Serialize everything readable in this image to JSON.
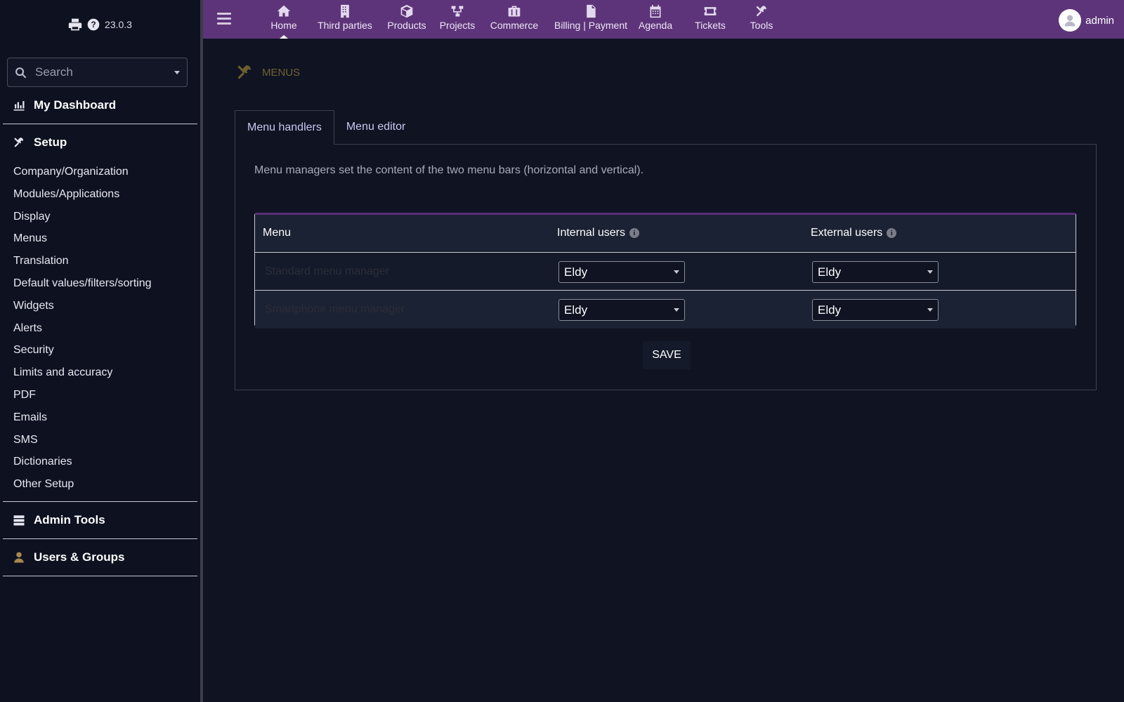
{
  "app": {
    "version": "23.0.3"
  },
  "search": {
    "placeholder": "Search"
  },
  "sidebar": {
    "dashboard_label": "My Dashboard",
    "setup_label": "Setup",
    "setup_items": [
      {
        "label": "Company/Organization"
      },
      {
        "label": "Modules/Applications"
      },
      {
        "label": "Display"
      },
      {
        "label": "Menus"
      },
      {
        "label": "Translation"
      },
      {
        "label": "Default values/filters/sorting"
      },
      {
        "label": "Widgets"
      },
      {
        "label": "Alerts"
      },
      {
        "label": "Security"
      },
      {
        "label": "Limits and accuracy"
      },
      {
        "label": "PDF"
      },
      {
        "label": "Emails"
      },
      {
        "label": "SMS"
      },
      {
        "label": "Dictionaries"
      },
      {
        "label": "Other Setup"
      }
    ],
    "admin_tools_label": "Admin Tools",
    "users_groups_label": "Users & Groups"
  },
  "topnav": {
    "items": [
      {
        "label": "Home",
        "icon": "home-icon"
      },
      {
        "label": "Third parties",
        "icon": "building-icon"
      },
      {
        "label": "Products",
        "icon": "cube-icon"
      },
      {
        "label": "Projects",
        "icon": "project-icon"
      },
      {
        "label": "Commerce",
        "icon": "briefcase-icon"
      },
      {
        "label": "Billing | Payment",
        "icon": "invoice-icon"
      },
      {
        "label": "Agenda",
        "icon": "calendar-icon"
      },
      {
        "label": "Tickets",
        "icon": "ticket-icon"
      },
      {
        "label": "Tools",
        "icon": "tools-icon"
      }
    ],
    "active": "Home"
  },
  "user": {
    "name": "admin"
  },
  "page": {
    "title": "MENUS",
    "tabs": [
      {
        "label": "Menu handlers"
      },
      {
        "label": "Menu editor"
      }
    ],
    "description": "Menu managers set the content of the two menu bars (horizontal and vertical)."
  },
  "table": {
    "headers": {
      "menu": "Menu",
      "internal": "Internal users",
      "external": "External users"
    },
    "rows": [
      {
        "label": "Standard menu manager",
        "internal": "Eldy",
        "external": "Eldy"
      },
      {
        "label": "Smartphone menu manager",
        "internal": "Eldy",
        "external": "Eldy"
      }
    ]
  },
  "buttons": {
    "save": "SAVE"
  },
  "colors": {
    "topbar": "#5d3479",
    "accent": "#5a2e7a",
    "background": "#0f1322",
    "sidebar": "#0d1120"
  }
}
